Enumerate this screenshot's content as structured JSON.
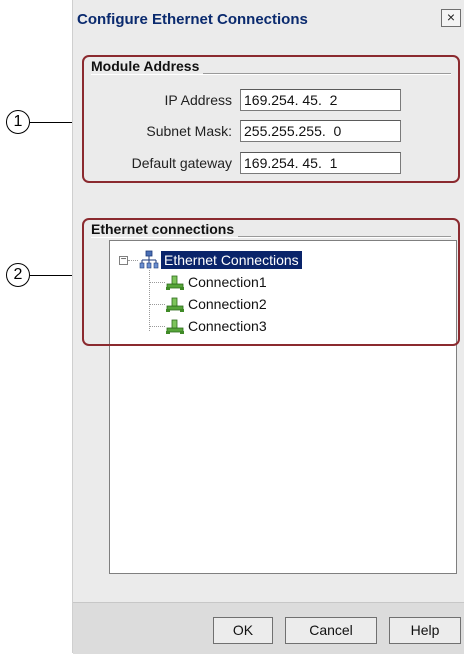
{
  "window": {
    "title": "Configure Ethernet Connections",
    "close_label": "×"
  },
  "module_address": {
    "group_label": "Module Address",
    "ip_label": "IP Address",
    "ip_value": "169.254. 45.  2",
    "subnet_label": "Subnet Mask:",
    "subnet_value": "255.255.255.  0",
    "gateway_label": "Default gateway",
    "gateway_value": "169.254. 45.  1"
  },
  "ethernet_connections": {
    "group_label": "Ethernet connections",
    "root": {
      "label": "Ethernet Connections",
      "expander": "−",
      "icon": "network-icon"
    },
    "children": [
      {
        "label": "Connection1",
        "icon": "connection-icon"
      },
      {
        "label": "Connection2",
        "icon": "connection-icon"
      },
      {
        "label": "Connection3",
        "icon": "connection-icon"
      }
    ]
  },
  "buttons": {
    "ok": "OK",
    "cancel": "Cancel",
    "help": "Help"
  },
  "callouts": {
    "one": "1",
    "two": "2"
  },
  "colors": {
    "annotation_frame": "#8b2a2f",
    "selection": "#0a246a",
    "title_text": "#0a2a6e"
  }
}
